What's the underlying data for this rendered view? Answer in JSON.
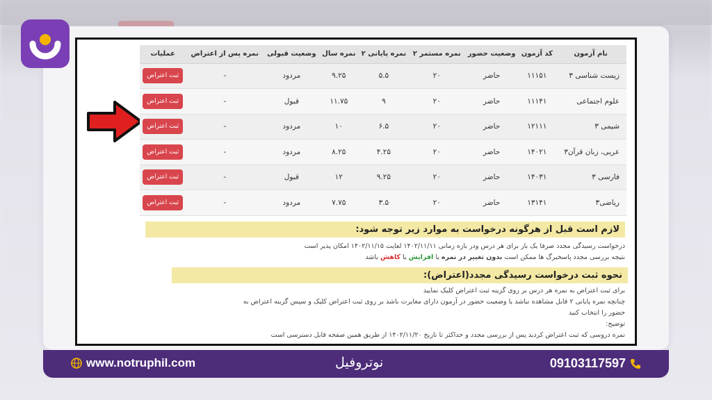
{
  "footer": {
    "website": "www.notruphil.com",
    "brand": "نوتروفیل",
    "phone": "09103117597",
    "globe_icon": "globe-icon",
    "phone_icon": "phone-icon"
  },
  "table": {
    "headers": [
      "نام آزمون",
      "کد آزمون",
      "وضعیت حضور",
      "نمره مستمر ۲",
      "نمره پایانی ۲",
      "نمره سال",
      "وضعیت قبولی",
      "نمره پس از اعتراض",
      "عملیات"
    ],
    "rows": [
      [
        "زیست شناسی ۳",
        "۱۱۱۵۱",
        "حاضر",
        "۲۰",
        "۵.۵",
        "۹.۲۵",
        "مردود",
        "-",
        "ثبت اعتراض"
      ],
      [
        "علوم اجتماعی",
        "۱۱۱۴۱",
        "حاضر",
        "۲۰",
        "۹",
        "۱۱.۷۵",
        "قبول",
        "-",
        "ثبت اعتراض"
      ],
      [
        "شیمی ۳",
        "۱۲۱۱۱",
        "حاضر",
        "۲۰",
        "۶.۵",
        "۱۰",
        "مردود",
        "-",
        "ثبت اعتراض"
      ],
      [
        "عربی، زبان قرآن۳",
        "۱۴۰۲۱",
        "حاضر",
        "۲۰",
        "۴.۲۵",
        "۸.۲۵",
        "مردود",
        "-",
        "ثبت اعتراض"
      ],
      [
        "فارسی ۳",
        "۱۴۰۳۱",
        "حاضر",
        "۲۰",
        "۹.۲۵",
        "۱۲",
        "قبول",
        "-",
        "ثبت اعتراض"
      ],
      [
        "ریاضی۳",
        "۱۳۱۴۱",
        "حاضر",
        "۲۰",
        "۳.۵",
        "۷.۷۵",
        "مردود",
        "-",
        "ثبت اعتراض"
      ]
    ]
  },
  "notice": {
    "heading1": "لازم است قبل از هرگونه درخواست به موارد زیر توجه شود:",
    "line1": "درخواست رسیدگی مجدد صرفا یک بار برای هر درس ودر بازه زمانی ۱۴۰۲/۱۱/۱۱ لغایت ۱۴۰۲/۱۱/۱۵ امکان پذیر است",
    "line2_a": "نتیجه بررسی مجدد پاسخبرگ ها ممکن است",
    "line2_b": "بدون تغییر در نمره",
    "line2_c": "یا",
    "line2_d": "افزایش",
    "line2_e": "یا",
    "line2_f": "کاهش",
    "line2_g": "باشد",
    "heading2": "نحوه ثبت درخواست رسیدگی مجدد(اعتراض):",
    "line3": "برای ثبت اعتراض به نمره هر درس بر روی گزینه ثبت اعتراض کلیک نمایید",
    "line4": "چنانچه نمره پایانی ۲ قابل مشاهده نباشد یا وضعیت حضور در آزمون دارای مغایرت باشد بر روی ثبت اعتراض کلیک و سپس گزینه اعتراض به",
    "line5": "حضور را انتخاب کنید",
    "line6": "توضیح:",
    "line7": "نمره دروسی که ثبت اعتراض کردید پس از بررسی مجدد و حداکثر تا تاریخ ۱۴۰۲/۱۱/۲۰ از طریق همین صفحه قابل دسترسی است"
  },
  "colors": {
    "brand_purple": "#4d2c7a",
    "accent_yellow": "#f4b400",
    "button_red": "#d9454c",
    "arrow_red": "#e02020"
  }
}
